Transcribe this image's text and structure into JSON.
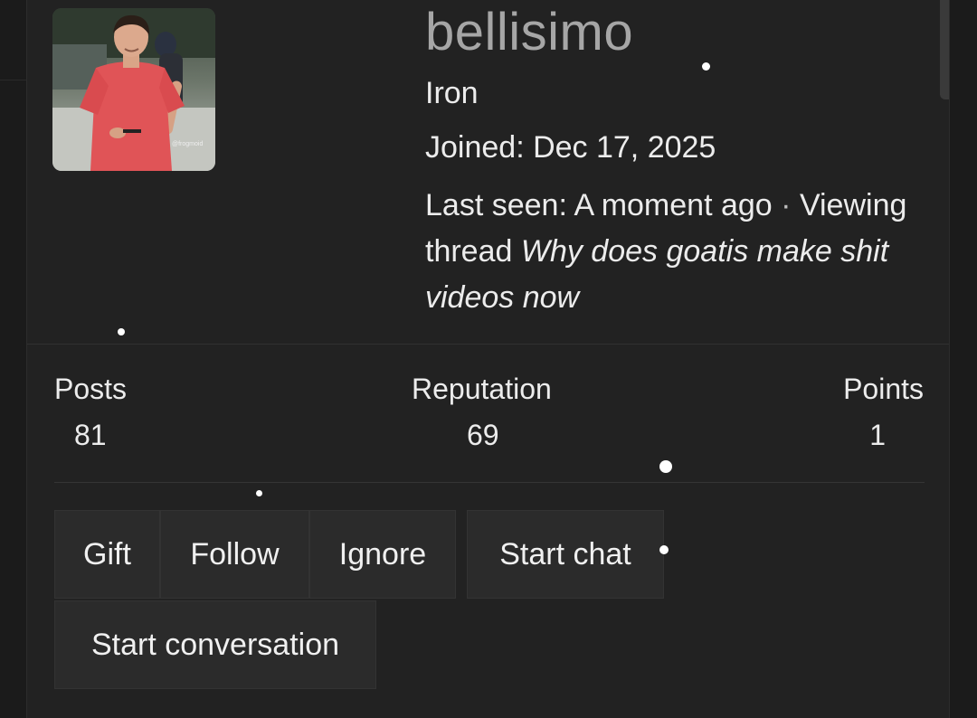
{
  "profile": {
    "username": "bellisimo",
    "rank": "Iron",
    "joined": "Joined: Dec 17, 2025",
    "last_seen_prefix": "Last seen: A moment ago",
    "separator": "·",
    "viewing_prefix": "Viewing thread",
    "viewing_thread_title": "Why does goatis make shit videos now",
    "avatar_watermark": "@frogmoid"
  },
  "stats": [
    {
      "label": "Posts",
      "value": "81"
    },
    {
      "label": "Reputation",
      "value": "69"
    },
    {
      "label": "Points",
      "value": "1"
    }
  ],
  "actions": {
    "gift": "Gift",
    "follow": "Follow",
    "ignore": "Ignore",
    "start_chat": "Start chat",
    "start_conversation": "Start conversation"
  },
  "colors": {
    "background": "#1b1b1b",
    "card": "#222222",
    "button": "#2b2b2b",
    "username": "#a6a6a6",
    "text": "#ececec"
  }
}
